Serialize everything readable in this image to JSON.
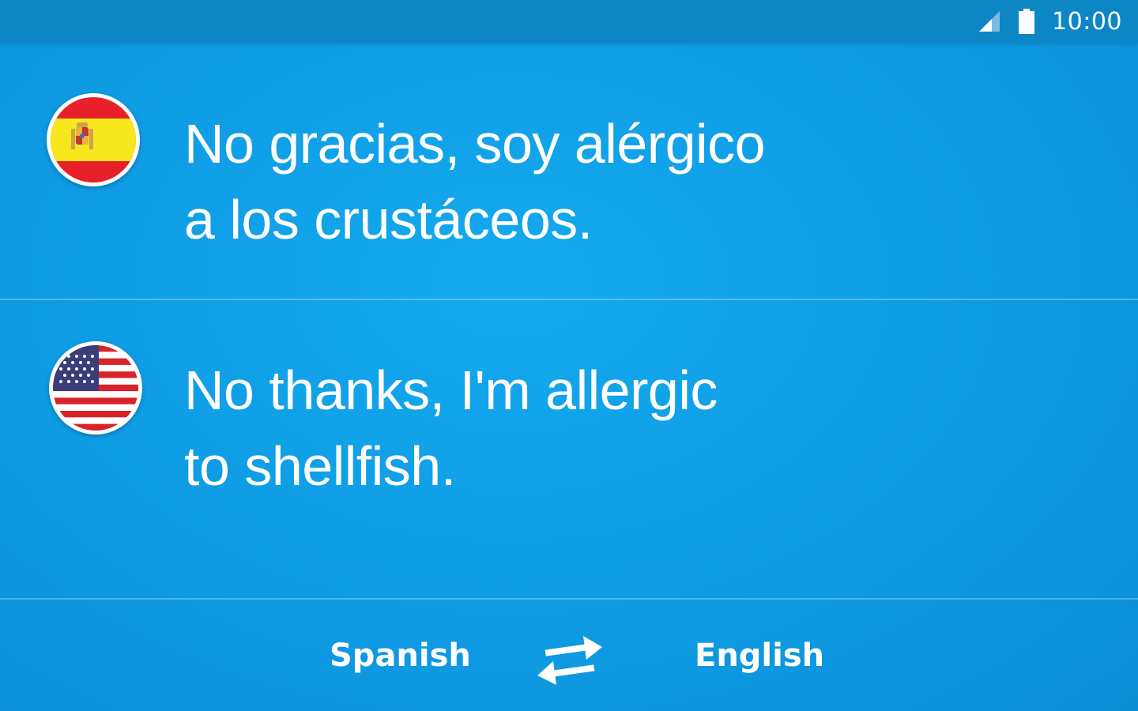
{
  "status_bar": {
    "time": "10:00",
    "icons": [
      "signal-icon",
      "battery-icon"
    ]
  },
  "source": {
    "language": "Spanish",
    "flag": "spain-flag-icon",
    "phrase": "No gracias, soy alérgico\na los crustáceos."
  },
  "target": {
    "language": "English",
    "flag": "us-flag-icon",
    "phrase": "No thanks, I'm allergic\nto shellfish."
  },
  "controls": {
    "swap_icon": "swap-arrows-icon"
  },
  "colors": {
    "background": "#0f9ee6",
    "status_bar": "#0d86c6",
    "text": "#ffffff",
    "spain_red": "#e8202a",
    "spain_yellow": "#f6e81c",
    "us_red": "#d8232a",
    "us_blue": "#3a3d78"
  }
}
